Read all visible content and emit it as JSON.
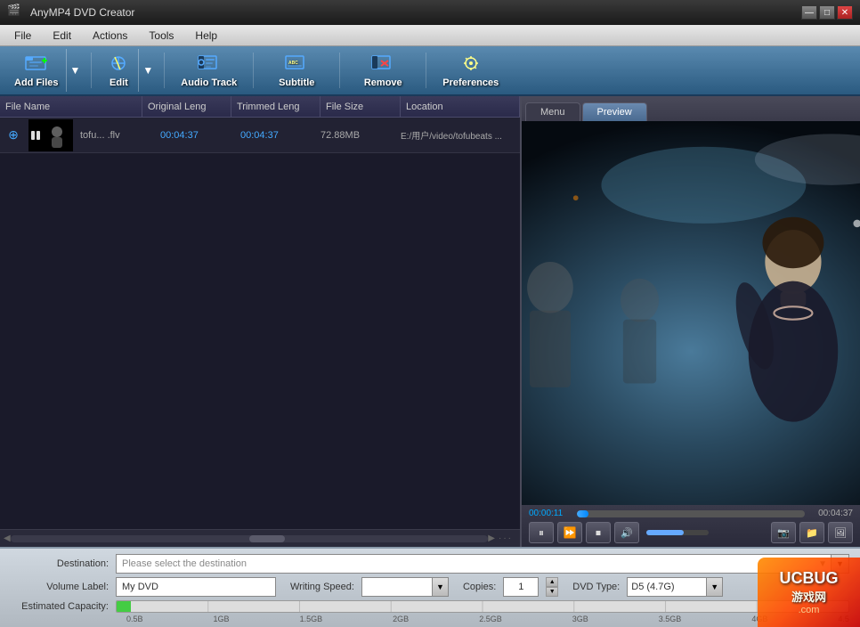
{
  "app": {
    "title": "AnyMP4 DVD Creator",
    "logo": "🎬"
  },
  "window_controls": {
    "minimize": "—",
    "maximize": "□",
    "close": "✕"
  },
  "menu": {
    "items": [
      "File",
      "Edit",
      "Actions",
      "Tools",
      "Help"
    ]
  },
  "toolbar": {
    "add_files": "Add Files",
    "edit": "Edit",
    "audio_track": "Audio Track",
    "subtitle": "Subtitle",
    "remove": "Remove",
    "preferences": "Preferences"
  },
  "file_list": {
    "headers": [
      "File Name",
      "Original Leng",
      "Trimmed Leng",
      "File Size",
      "Location"
    ],
    "rows": [
      {
        "filename": "tofu... .flv",
        "original": "00:04:37",
        "trimmed": "00:04:37",
        "size": "72.88MB",
        "location": "E:/用户/video/tofubeats ..."
      }
    ]
  },
  "preview": {
    "tabs": [
      "Menu",
      "Preview"
    ],
    "active_tab": "Preview",
    "current_time": "00:00:11",
    "end_time": "00:04:37",
    "progress_pct": 4
  },
  "player_controls": {
    "pause": "⏸",
    "forward": "⏩",
    "stop": "⏹",
    "volume": "🔊",
    "snapshot": "📷",
    "folder": "📁",
    "gallery": "🖼"
  },
  "bottom": {
    "destination_label": "Destination:",
    "destination_placeholder": "Please select the destination",
    "volume_label": "Volume Label:",
    "volume_value": "My DVD",
    "writing_speed_label": "Writing Speed:",
    "writing_speed_value": "",
    "copies_label": "Copies:",
    "copies_value": "1",
    "dvd_type_label": "DVD Type:",
    "dvd_type_value": "D5 (4.7G)",
    "capacity_label": "Estimated Capacity:",
    "capacity_ticks": [
      "0.5B",
      "1GB",
      "1.5GB",
      "2GB",
      "2.5GB",
      "3GB",
      "3.5GB",
      "4GB",
      "4.5"
    ]
  },
  "watermark": {
    "line1": "UCBUG",
    "line2": "游戏网",
    "line3": ".com"
  }
}
